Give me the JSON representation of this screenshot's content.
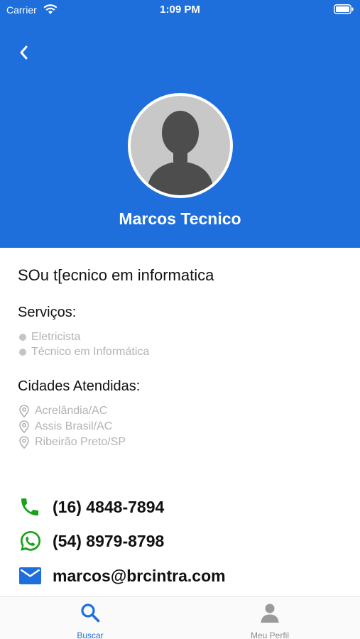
{
  "status_bar": {
    "carrier": "Carrier",
    "time": "1:09 PM"
  },
  "header": {
    "name": "Marcos Tecnico",
    "background_color": "#1e6fdc"
  },
  "profile": {
    "bio": "SOu t[ecnico em informatica",
    "services_title": "Serviços:",
    "services": [
      "Eletricista",
      "Técnico em Informática"
    ],
    "cities_title": "Cidades Atendidas:",
    "cities": [
      "Acrelândia/AC",
      "Assis Brasil/AC",
      "Ribeirão Preto/SP"
    ]
  },
  "contacts": {
    "phone": "(16) 4848-7894",
    "whatsapp": "(54) 8979-8798",
    "email": "marcos@brcintra.com"
  },
  "tabbar": {
    "search_label": "Buscar",
    "profile_label": "Meu Perfil",
    "active_color": "#1e6fdc"
  },
  "icons": [
    "wifi-icon",
    "battery-icon",
    "back-icon",
    "avatar-placeholder",
    "location-pin-icon",
    "phone-icon",
    "whatsapp-icon",
    "email-icon",
    "search-icon",
    "user-icon"
  ]
}
